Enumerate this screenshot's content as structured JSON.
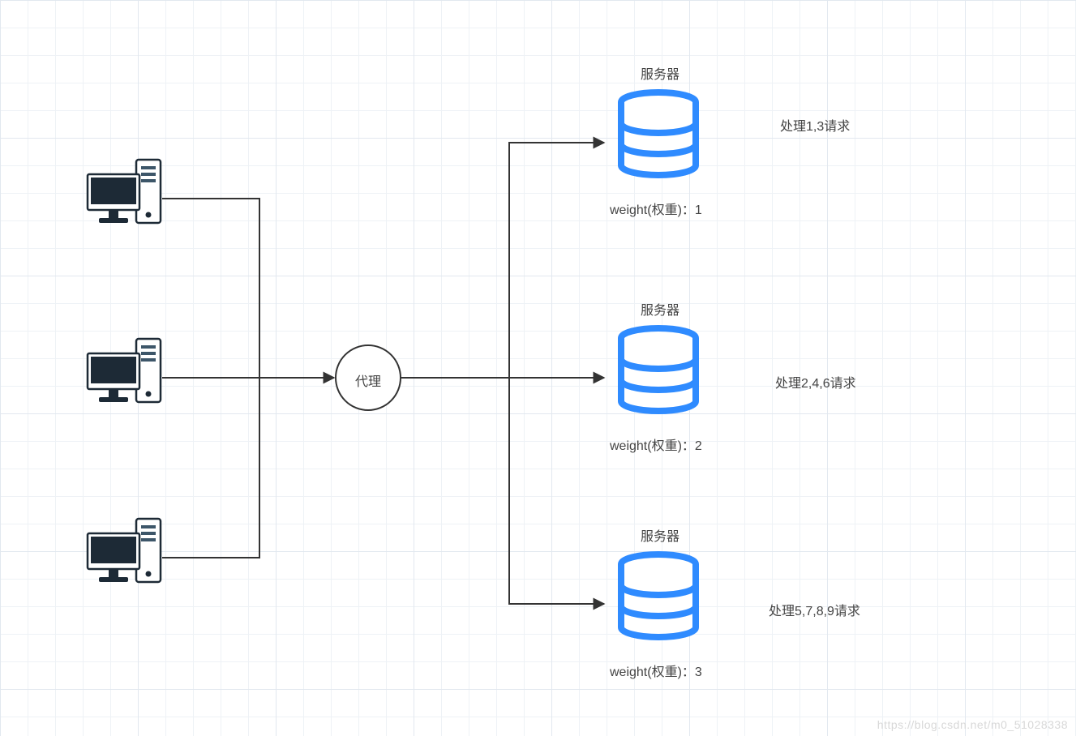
{
  "proxy": {
    "label": "代理"
  },
  "servers": [
    {
      "title": "服务器",
      "weight_label": "weight(权重)：1",
      "handles": "处理1,3请求"
    },
    {
      "title": "服务器",
      "weight_label": "weight(权重)：2",
      "handles": "处理2,4,6请求"
    },
    {
      "title": "服务器",
      "weight_label": "weight(权重)：3",
      "handles": "处理5,7,8,9请求"
    }
  ],
  "watermark": "https://blog.csdn.net/m0_51028338",
  "colors": {
    "server_icon": "#2f8bff",
    "line": "#333333"
  }
}
